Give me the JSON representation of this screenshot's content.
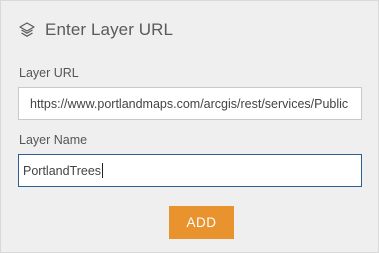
{
  "panel": {
    "title": "Enter Layer URL",
    "icon": "layers-icon"
  },
  "form": {
    "url_label": "Layer URL",
    "url_value": "https://www.portlandmaps.com/arcgis/rest/services/Public",
    "name_label": "Layer Name",
    "name_value": "PortlandTrees"
  },
  "actions": {
    "add_label": "ADD"
  },
  "colors": {
    "accent": "#e9932f",
    "focus_border": "#2d5f93",
    "background": "#efefef"
  }
}
